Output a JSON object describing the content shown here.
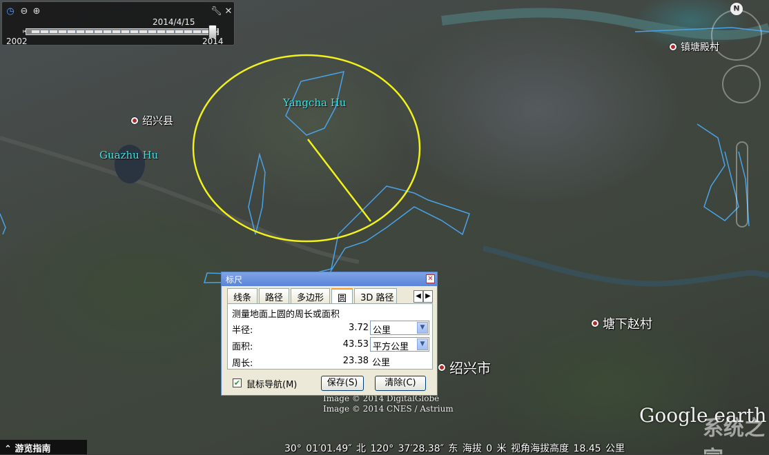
{
  "map": {
    "places": [
      {
        "name": "绍兴县"
      },
      {
        "name": "镇塘殿村"
      },
      {
        "name": "塘下赵村"
      },
      {
        "name": "绍兴市"
      }
    ],
    "lakes": [
      {
        "name": "Yangcha Hu"
      },
      {
        "name": "Guazhu Hu"
      }
    ],
    "credits": [
      "Image © 2014 DigitalGlobe",
      "Image © 2014 CNES / Astrium"
    ]
  },
  "timebar": {
    "date": "2014/4/15",
    "start_year": "2002",
    "end_year": "2014",
    "position": 1.0
  },
  "ruler_dialog": {
    "title": "标尺",
    "close": "✕",
    "tabs": [
      "线条",
      "路径",
      "多边形",
      "圆",
      "3D 路径"
    ],
    "active_tab": "圆",
    "description": "测量地面上圆的周长或面积",
    "radius": {
      "label": "半径:",
      "value": "3.72",
      "unit": "公里"
    },
    "area": {
      "label": "面积:",
      "value": "43.53",
      "unit": "平方公里"
    },
    "perimeter": {
      "label": "周长:",
      "value": "23.38",
      "unit": "公里"
    },
    "mouse_nav": {
      "label": "鼠标导航(M)",
      "checked": true
    },
    "save_button": "保存(S)",
    "clear_button": "清除(C)"
  },
  "status_bar": {
    "guide": "游览指南",
    "coordinates": "30° 01′01.49″ 北 120° 37′28.38″ 东 海拔   0 米  视角海拔高度  18.45 公里"
  },
  "branding": {
    "logo": "Google earth",
    "watermark": "系统之家"
  },
  "colors": {
    "circle": "#f2f21a",
    "boundary": "#4aa3e8",
    "place_dot": "#b42a2a",
    "lake_label": "#35e3e3"
  },
  "icons": {
    "clock": "clock-icon",
    "zoom_out": "zoom-out-icon",
    "zoom_in": "zoom-in-icon",
    "wrench": "wrench-icon",
    "close": "close-icon",
    "compass": "north-compass-icon"
  },
  "compass_letter": "N"
}
